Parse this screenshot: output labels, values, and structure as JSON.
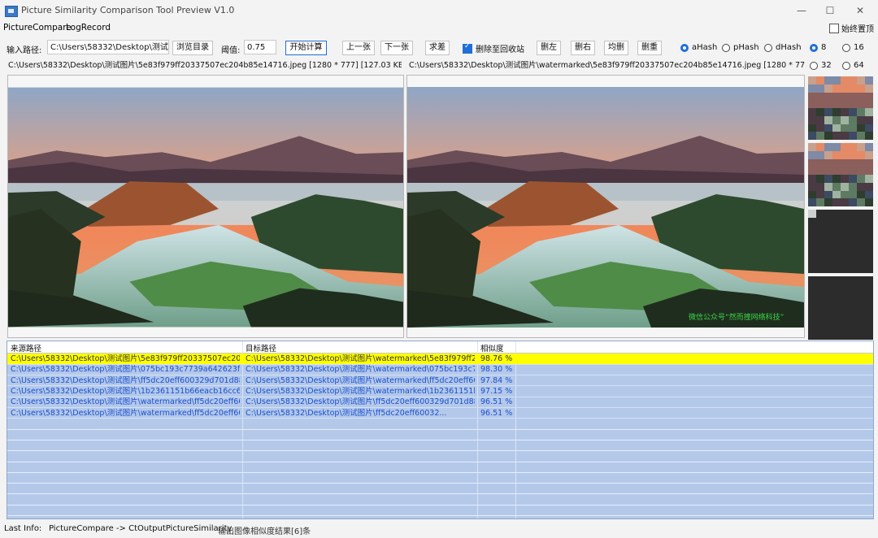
{
  "window": {
    "title": "Picture Similarity Comparison Tool Preview V1.0",
    "minimize": "—",
    "maximize": "☐",
    "close": "✕"
  },
  "menu": {
    "items": [
      "PictureCompare",
      "LogRecord"
    ],
    "always_on_top": "始终置顶"
  },
  "toolbar": {
    "input_label": "输入路径:",
    "input_path": "C:\\Users\\58332\\Desktop\\测试图片",
    "browse": "浏览目录",
    "threshold_label": "阈值:",
    "threshold": "0.75",
    "start": "开始计算",
    "prev": "上一张",
    "next": "下一张",
    "diff": "求差",
    "delete_to_bin": "删除至回收站",
    "delete_left": "删左",
    "delete_right": "删右",
    "delete_both": "均删",
    "delete_dup": "删重",
    "hash_options": [
      "aHash",
      "pHash",
      "dHash"
    ],
    "selected_hash": "aHash",
    "size_options": [
      "8",
      "16",
      "32",
      "64"
    ],
    "selected_size": "8"
  },
  "info": {
    "left": "C:\\Users\\58332\\Desktop\\测试图片\\5e83f979ff20337507ec204b85e14716.jpeg [1280 * 777] [127.03 KB] [07A1E4D98",
    "right": "C:\\Users\\58332\\Desktop\\测试图片\\watermarked\\5e83f979ff20337507ec204b85e14716.jpeg [1280 * 777] [269.41 KB"
  },
  "watermark": "微信公众号“然而撞网络科技”",
  "colors": {
    "accent": "#1f6fd6",
    "row_selected": "#ffff00",
    "table_bg": "#b4c9ea",
    "row_text": "#1a4fcf"
  },
  "table": {
    "headers": [
      "来源路径",
      "目标路径",
      "相似度"
    ],
    "rows": [
      [
        "C:\\Users\\58332\\Desktop\\测试图片\\5e83f979ff20337507ec204b85e...",
        "C:\\Users\\58332\\Desktop\\测试图片\\watermarked\\5e83f979ff20337...",
        "98.76 %"
      ],
      [
        "C:\\Users\\58332\\Desktop\\测试图片\\075bc193c7739a642623f95430...",
        "C:\\Users\\58332\\Desktop\\测试图片\\watermarked\\075bc193c7739a...",
        "98.30 %"
      ],
      [
        "C:\\Users\\58332\\Desktop\\测试图片\\ff5dc20eff600329d701d8887fb...",
        "C:\\Users\\58332\\Desktop\\测试图片\\watermarked\\ff5dc20eff60032...",
        "97.84 %"
      ],
      [
        "C:\\Users\\58332\\Desktop\\测试图片\\1b2361151b66eacb16cc6eedac...",
        "C:\\Users\\58332\\Desktop\\测试图片\\watermarked\\1b2361151b66ea...",
        "97.15 %"
      ],
      [
        "C:\\Users\\58332\\Desktop\\测试图片\\watermarked\\ff5dc20eff600329...",
        "C:\\Users\\58332\\Desktop\\测试图片\\ff5dc20eff600329d701d8887fb...",
        "96.51 %"
      ],
      [
        "C:\\Users\\58332\\Desktop\\测试图片\\watermarked\\ff5dc20eff600329...",
        "C:\\Users\\58332\\Desktop\\测试图片\\ff5dc20eff60032...",
        "96.51 %"
      ]
    ]
  },
  "status": {
    "label": "Last Info:",
    "route": "PictureCompare -> CtOutputPictureSimilarity",
    "message": "输出图像相似度结果[6]条"
  }
}
